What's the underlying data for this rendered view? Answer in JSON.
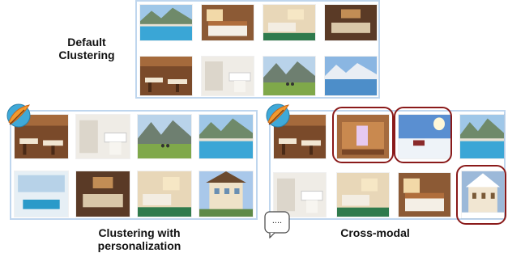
{
  "labels": {
    "default_line1": "Default",
    "default_line2": "Clustering",
    "personalization_line1": "Clustering with",
    "personalization_line2": "personalization",
    "cross_modal": "Cross-modal",
    "chat_bubble_text": "...."
  },
  "panels": {
    "default": {
      "images": [
        {
          "name": "pool-mountain-view",
          "scene": "pool"
        },
        {
          "name": "bedroom-wood",
          "scene": "bedroom"
        },
        {
          "name": "hotel-room-green-carpet",
          "scene": "room"
        },
        {
          "name": "lounge-brown",
          "scene": "lounge"
        },
        {
          "name": "restaurant-wood",
          "scene": "restaurant"
        },
        {
          "name": "bathroom",
          "scene": "bathroom"
        },
        {
          "name": "hikers-meadow",
          "scene": "mountain"
        },
        {
          "name": "lake-mountain",
          "scene": "lake"
        }
      ]
    },
    "personalization": {
      "images": [
        {
          "name": "restaurant-wood",
          "scene": "restaurant"
        },
        {
          "name": "bathroom",
          "scene": "bathroom"
        },
        {
          "name": "hikers-meadow",
          "scene": "mountain"
        },
        {
          "name": "pool-mountain-view",
          "scene": "pool"
        },
        {
          "name": "glass-lobby",
          "scene": "lobby"
        },
        {
          "name": "lounge-brown",
          "scene": "lounge"
        },
        {
          "name": "hotel-room-green-carpet",
          "scene": "room"
        },
        {
          "name": "hotel-exterior",
          "scene": "exterior"
        }
      ]
    },
    "cross_modal": {
      "images": [
        {
          "name": "stube-restaurant",
          "scene": "restaurant"
        },
        {
          "name": "sauna",
          "scene": "sauna",
          "highlighted": true
        },
        {
          "name": "snow-sunbathing",
          "scene": "snow",
          "highlighted": true
        },
        {
          "name": "indoor-pool",
          "scene": "pool"
        },
        {
          "name": "bright-lounge",
          "scene": "bathroom"
        },
        {
          "name": "hotel-room-wood",
          "scene": "room"
        },
        {
          "name": "bedroom-red",
          "scene": "bedroom"
        },
        {
          "name": "winter-hotel-exterior",
          "scene": "winter",
          "highlighted": true
        }
      ]
    }
  },
  "colors": {
    "panel_border": "#bfd6ee",
    "highlight_border": "#8a1a1a"
  },
  "icons": [
    "feather-quill-icon",
    "chat-bubble-icon"
  ]
}
